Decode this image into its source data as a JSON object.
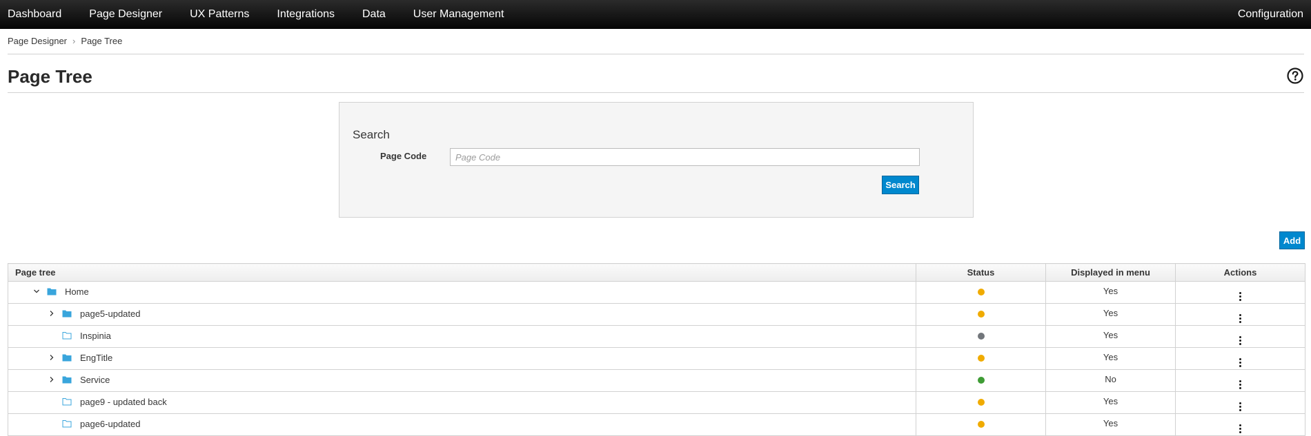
{
  "nav": {
    "items": [
      "Dashboard",
      "Page Designer",
      "UX Patterns",
      "Integrations",
      "Data",
      "User Management"
    ],
    "right": "Configuration"
  },
  "breadcrumb": {
    "parent": "Page Designer",
    "separator": "›",
    "current": "Page Tree"
  },
  "page": {
    "title": "Page Tree",
    "help_icon": "question-circle-icon"
  },
  "search": {
    "heading": "Search",
    "page_code_label": "Page Code",
    "page_code_placeholder": "Page Code",
    "page_code_value": "",
    "button": "Search"
  },
  "add_button": "Add",
  "table": {
    "headers": {
      "tree": "Page tree",
      "status": "Status",
      "menu": "Displayed in menu",
      "actions": "Actions"
    },
    "rows": [
      {
        "name": "Home",
        "expander": "expanded",
        "folder": "filled",
        "status": "#f0ab00",
        "menu": "Yes"
      },
      {
        "name": "page5-updated",
        "expander": "collapsed",
        "folder": "filled",
        "status": "#f0ab00",
        "menu": "Yes"
      },
      {
        "name": "Inspinia",
        "expander": "none",
        "folder": "outline",
        "status": "#72767b",
        "menu": "Yes"
      },
      {
        "name": "EngTitle",
        "expander": "collapsed",
        "folder": "filled",
        "status": "#f0ab00",
        "menu": "Yes"
      },
      {
        "name": "Service",
        "expander": "collapsed",
        "folder": "filled",
        "status": "#3f9c35",
        "menu": "No"
      },
      {
        "name": "page9 - updated back",
        "expander": "none",
        "folder": "outline",
        "status": "#f0ab00",
        "menu": "Yes"
      },
      {
        "name": "page6-updated",
        "expander": "none",
        "folder": "outline",
        "status": "#f0ab00",
        "menu": "Yes"
      }
    ]
  },
  "colors": {
    "accent": "#0088ce",
    "folder": "#39a5dc",
    "navbar": "#030303"
  }
}
